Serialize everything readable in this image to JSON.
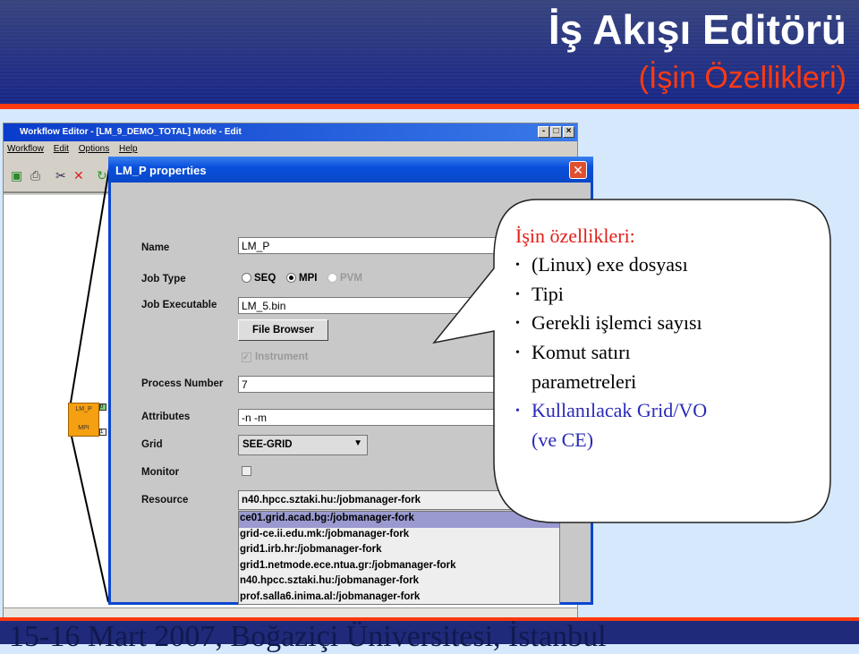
{
  "slide": {
    "title": "İş Akışı Editörü",
    "subtitle": "(İşin Özellikleri)",
    "footer": "15-16 Mart 2007, Boğaziçi Üniversitesi, İstanbul"
  },
  "workflow_editor": {
    "title": "Workflow Editor - [LM_9_DEMO_TOTAL] Mode - Edit",
    "menu": [
      "Workflow",
      "Edit",
      "Options",
      "Help"
    ],
    "node": {
      "name": "LM_P",
      "type": "MPI",
      "port_in": "0",
      "port_out": "1",
      "color": "#f5a010"
    }
  },
  "dialog": {
    "title": "LM_P properties",
    "fields": {
      "name_label": "Name",
      "name_value": "LM_P",
      "job_type_label": "Job Type",
      "job_type_options": [
        "SEQ",
        "MPI",
        "PVM"
      ],
      "job_type_selected": "MPI",
      "exec_label": "Job Executable",
      "exec_value": "LM_5.bin",
      "file_browser": "File Browser",
      "instrument_label": "Instrument",
      "instrument_checked": true,
      "process_label": "Process Number",
      "process_value": "7",
      "attributes_label": "Attributes",
      "attributes_value": "-n -m",
      "grid_label": "Grid",
      "grid_value": "SEE-GRID",
      "monitor_label": "Monitor",
      "monitor_checked": false,
      "resource_label": "Resource",
      "resource_value": "n40.hpcc.sztaki.hu:/jobmanager-fork"
    },
    "resource_options": [
      "ce01.grid.acad.bg:/jobmanager-fork",
      "grid-ce.ii.edu.mk:/jobmanager-fork",
      "grid1.irb.hr:/jobmanager-fork",
      "grid1.netmode.ece.ntua.gr:/jobmanager-fork",
      "n40.hpcc.sztaki.hu:/jobmanager-fork",
      "prof.salla6.inima.al:/jobmanager-fork"
    ]
  },
  "callout": {
    "heading": "İşin özellikleri:",
    "items": [
      "(Linux) exe dosyası",
      "Tipi",
      "Gerekli işlemci sayısı",
      "Komut satırı",
      "parametreleri",
      "Kullanılacak Grid/VO",
      "(ve CE)"
    ]
  },
  "colors": {
    "header": "#1b2a85",
    "accent": "#ff3a10",
    "slide_bg": "#d6e8fb",
    "dialog_title": "#0a50dc",
    "highlight": "#9a9ad0"
  }
}
